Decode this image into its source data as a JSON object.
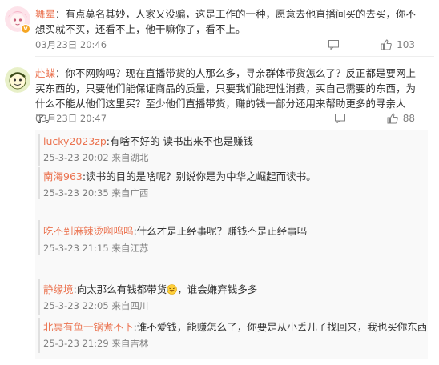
{
  "comments": [
    {
      "username": "舞晕",
      "content": "：有点莫名其妙，人家又没骗，这是工作的一种，愿意去他直播间买的去买，你不想买就不买，还看不上，他干嘛你了，看不上。",
      "time": "03月23日 20:46",
      "likes": "103",
      "avatar_icon": "pink-anime-avatar-icon",
      "badge_icon": "verified-badge-icon"
    },
    {
      "username": "赴蝶",
      "content": "：你不网购吗？现在直播带货的人那么多，寻亲群体带货怎么了？反正都是要网上买东西的，只要他们能保证商品的质量，只要我们能理性消费，买自己需要的东西，为什么不能从他们这里买？至少他们直播带货，赚的钱一部分还用来帮助更多的寻亲人了。",
      "time": "03月23日 20:47",
      "likes": "88",
      "avatar_icon": "cartoon-face-avatar-icon"
    }
  ],
  "replies": [
    {
      "username": "lucky2023zp",
      "content": ":有啥不好的 读书出来不也是赚钱",
      "time": "25-3-23 20:02",
      "location": "来自湖北"
    },
    {
      "username": "南海963",
      "content": ":读书的目的是啥呢？别说你是为中华之崛起而读书。",
      "time": "25-3-23 20:35",
      "location": "来自广西"
    },
    {
      "username": "吃不到麻辣烫啊呜呜",
      "content": ":什么才是正经事呢？赚钱不是正经事吗",
      "time": "25-3-23 21:15",
      "location": "来自江苏"
    },
    {
      "username": "静缘境",
      "content": ":向太那么有钱都带货",
      "content_after_emoji": "，谁会嫌弃钱多多",
      "emoji_icon": "laughing-emoji-icon",
      "time": "25-3-23 22:05",
      "location": "来自四川"
    },
    {
      "username": "北冥有鱼一锅煮不下",
      "content": ":谁不爱钱，能赚怎么了，你要是从小丢儿子找回来，我也买你东西",
      "time": "25-3-23 21:29",
      "location": "来自吉林"
    }
  ],
  "colors": {
    "username": "#eb7350",
    "text": "#333333",
    "meta": "#808080",
    "reply_bg": "#f9f9f9"
  }
}
